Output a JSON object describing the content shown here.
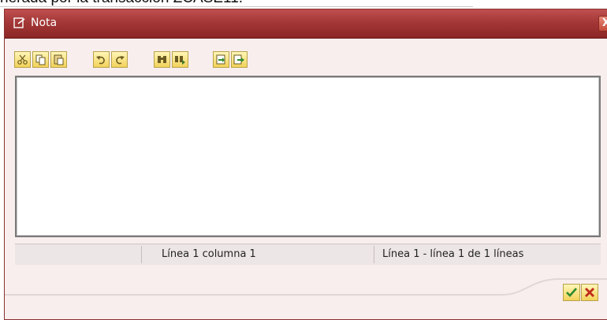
{
  "background": {
    "text": "nerada por la transacción ZCASE11."
  },
  "dialog": {
    "title": "Nota",
    "close_glyph": "X"
  },
  "toolbar": {
    "buttons": [
      {
        "name": "cut",
        "icon": "scissors-icon"
      },
      {
        "name": "copy",
        "icon": "copy-icon"
      },
      {
        "name": "paste",
        "icon": "paste-icon"
      },
      {
        "name": "undo",
        "icon": "undo-icon"
      },
      {
        "name": "redo",
        "icon": "redo-icon"
      },
      {
        "name": "find",
        "icon": "binoculars-icon"
      },
      {
        "name": "find-next",
        "icon": "binoculars-next-icon"
      },
      {
        "name": "import",
        "icon": "import-icon"
      },
      {
        "name": "export",
        "icon": "export-icon"
      }
    ]
  },
  "editor": {
    "content": ""
  },
  "statusbar": {
    "cell1": "",
    "position": "Línea 1 columna 1",
    "lines": "Línea 1 - línea 1 de 1 líneas"
  },
  "actions": {
    "confirm_icon": "checkmark-icon",
    "cancel_icon": "cancel-x-icon"
  },
  "colors": {
    "titlebar": "#a43737",
    "dialog_bg": "#f8eeee",
    "button_yellow": "#f2d25a"
  }
}
